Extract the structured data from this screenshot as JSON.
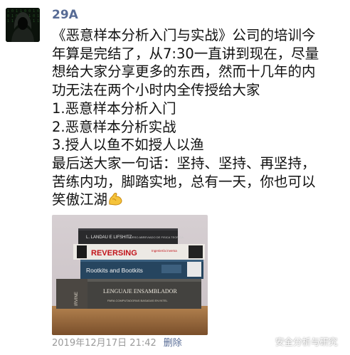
{
  "post": {
    "author": "29A",
    "lines": [
      "《恶意样本分析入门与实战》公司的培训今",
      "年算是完结了，从7:30一直讲到现在，尽量",
      "想给大家分享更多的东西，然而十几年的内",
      "功无法在两个小时内全传授给大家",
      "1.恶意样本分析入门",
      "2.恶意样本分析实战",
      "3.授人以鱼不如授人以渔",
      "最后送大家一句话：坚持、坚持、再坚持，",
      "苦练内功，脚踏实地，总有一天，你也可以",
      "笑傲江湖"
    ],
    "emoji_icon": "flexed-biceps-icon",
    "timestamp": "2019年12月17日 21:42",
    "delete_label": "删除"
  },
  "photo": {
    "books": [
      {
        "title": "L. LANDAU E LIFSHITZ",
        "subtitle": "CURSO ABREVIADO DE FISICA TEORICA"
      },
      {
        "title": "REVERSING",
        "subtitle": "Ingeniería inversa"
      },
      {
        "title": "Rootkits and Bootkits",
        "subtitle": ""
      },
      {
        "title": "LENGUAJE ENSAMBLADOR",
        "subtitle": "PARA COMPUTADORAS BASADAS EN INTEL",
        "spine_author": "IRVINE"
      }
    ]
  },
  "watermark": {
    "text": "安全分析与研究",
    "icon": "wechat-channel-icon"
  },
  "colors": {
    "link": "#576b95",
    "meta": "#9a9a9a",
    "text": "#111111"
  }
}
